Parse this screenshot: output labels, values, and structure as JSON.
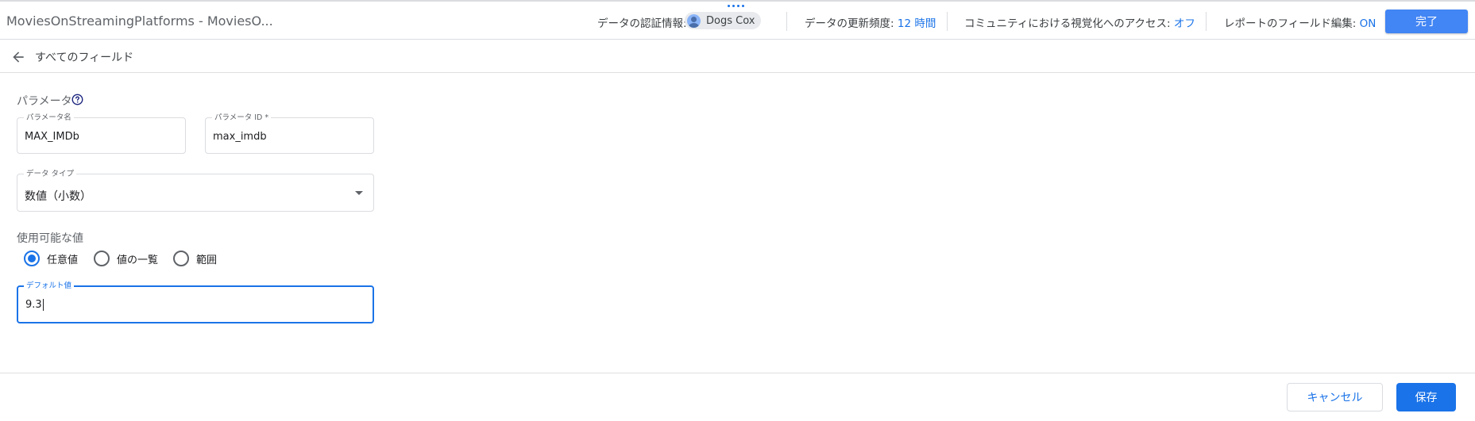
{
  "header": {
    "app_title": "MoviesOnStreamingPlatforms - MoviesO...",
    "credentials_label": "データの認証情報:",
    "credentials_user": "Dogs Cox",
    "refresh_label": "データの更新頻度:",
    "refresh_value": "12 時間",
    "community_label": "コミュニティにおける視覚化へのアクセス:",
    "community_value": "オフ",
    "field_edit_label": "レポートのフィールド編集:",
    "field_edit_value": "ON",
    "done_button": "完了"
  },
  "subheader": {
    "back_label": "すべてのフィールド"
  },
  "form": {
    "section_title": "パラメータ",
    "param_name": {
      "label": "パラメータ名",
      "value": "MAX_IMDb"
    },
    "param_id": {
      "label": "パラメータ ID *",
      "value": "max_imdb"
    },
    "data_type": {
      "label": "データ タイプ",
      "value": "数値（小数）"
    },
    "allowed_values_title": "使用可能な値",
    "radio_options": [
      {
        "label": "任意値",
        "checked": true
      },
      {
        "label": "値の一覧",
        "checked": false
      },
      {
        "label": "範囲",
        "checked": false
      }
    ],
    "default_value": {
      "label": "デフォルト値",
      "value": "9.3"
    }
  },
  "footer": {
    "cancel_button": "キャンセル",
    "save_button": "保存"
  },
  "colors": {
    "accent": "#1a73e8",
    "done_button": "#4285f4"
  }
}
